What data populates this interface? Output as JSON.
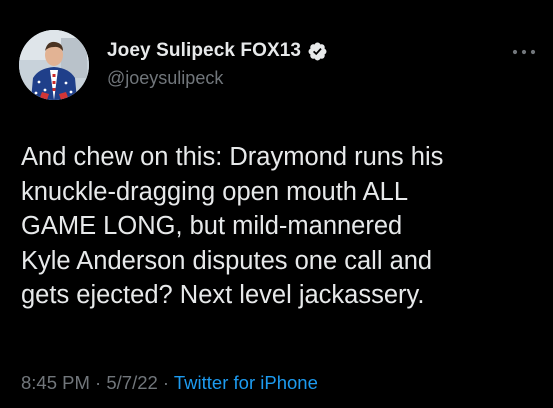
{
  "tweet": {
    "author": {
      "display_name": "Joey Sulipeck FOX13",
      "handle": "@joeysulipeck",
      "verified": true,
      "avatar_icon": "profile-photo"
    },
    "text": "And chew on this:  Draymond runs his\nknuckle-dragging open mouth ALL\nGAME LONG, but mild-mannered\nKyle Anderson disputes one call and\ngets ejected?  Next level jackassery.",
    "time": "8:45 PM",
    "separator": " · ",
    "date": "5/7/22",
    "source": "Twitter for iPhone"
  },
  "icons": {
    "verified": "verified-badge-icon",
    "more": "more-options-icon"
  },
  "colors": {
    "background": "#000000",
    "text": "#e7e9ea",
    "secondary": "#71767b",
    "accent": "#1d9bf0"
  }
}
